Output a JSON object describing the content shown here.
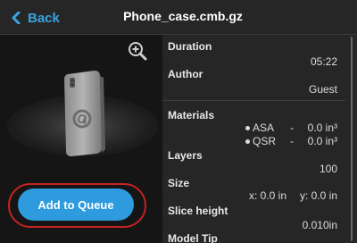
{
  "header": {
    "back_label": "Back",
    "title": "Phone_case.cmb.gz"
  },
  "icons": {
    "back": "chevron-left-icon",
    "zoom": "zoom-in-icon"
  },
  "preview": {
    "queue_button_label": "Add to Queue"
  },
  "details": {
    "duration_label": "Duration",
    "duration_value": "05:22",
    "author_label": "Author",
    "author_value": "Guest",
    "materials_label": "Materials",
    "materials": [
      {
        "name": "ASA",
        "sep": "-",
        "amount": "0.0 in³"
      },
      {
        "name": "QSR",
        "sep": "-",
        "amount": "0.0 in³"
      }
    ],
    "layers_label": "Layers",
    "layers_value": "100",
    "size_label": "Size",
    "size_x": "x: 0.0 in",
    "size_y": "y: 0.0 in",
    "slice_height_label": "Slice height",
    "slice_height_value": "0.010in",
    "model_tip_label": "Model Tip"
  },
  "colors": {
    "accent": "#2d9bdd",
    "highlight_ring": "#c52222",
    "background": "#262626"
  }
}
